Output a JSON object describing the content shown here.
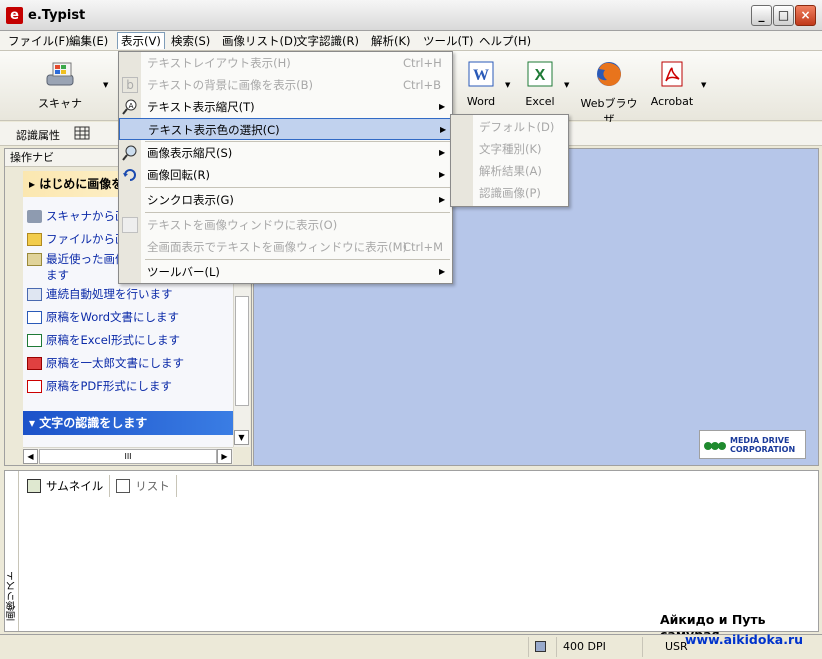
{
  "window": {
    "title": "e.Typist",
    "logo": "e",
    "minimize": "_",
    "maximize": "□",
    "close": "×"
  },
  "menubar": [
    {
      "label": "ファイル(F)"
    },
    {
      "label": "編集(E)"
    },
    {
      "label": "表示(V)"
    },
    {
      "label": "検索(S)"
    },
    {
      "label": "画像リスト(D)"
    },
    {
      "label": "文字認識(R)"
    },
    {
      "label": "解析(K)"
    },
    {
      "label": "ツール(T)"
    },
    {
      "label": "ヘルプ(H)"
    }
  ],
  "toolbar": {
    "scanner": "スキャナ",
    "word": "Word",
    "excel": "Excel",
    "browser": "Webブラウザ",
    "acrobat": "Acrobat"
  },
  "toolbar2": {
    "recognition_attr": "認識属性"
  },
  "left_panel": {
    "header": "操作ナビ",
    "section1": "はじめに画像を",
    "links": [
      "スキャナから画",
      "ファイルから画",
      "最近使った画像",
      "ます",
      "連続自動処理を行います",
      "原稿をWord文書にします",
      "原稿をExcel形式にします",
      "原稿を一太郎文書にします",
      "原稿をPDF形式にします"
    ],
    "section2": "文字の認識をします",
    "scroll_label": "III"
  },
  "viewer": {
    "logo_line1": "MEDIA DRIVE",
    "logo_line2": "CORPORATION"
  },
  "bottom_panel": {
    "side_label": "画像リスト",
    "tab_thumbnail": "サムネイル",
    "tab_list": "リスト"
  },
  "status": {
    "dpi": "400 DPI",
    "user": "USR"
  },
  "watermark": {
    "line1": "Айкидо и Путь самурая",
    "line2": "www.aikidoka.ru"
  },
  "view_menu": {
    "items": [
      {
        "label": "テキストレイアウト表示(H)",
        "shortcut": "Ctrl+H",
        "disabled": true
      },
      {
        "label": "テキストの背景に画像を表示(B)",
        "shortcut": "Ctrl+B",
        "disabled": true
      },
      {
        "label": "テキスト表示縮尺(T)",
        "submenu": true
      },
      {
        "label": "テキスト表示色の選択(C)",
        "submenu": true,
        "highlighted": true
      },
      {
        "label": "画像表示縮尺(S)",
        "submenu": true
      },
      {
        "label": "画像回転(R)",
        "submenu": true
      },
      {
        "label": "シンクロ表示(G)",
        "submenu": true
      },
      {
        "label": "テキストを画像ウィンドウに表示(O)",
        "disabled": true
      },
      {
        "label": "全画面表示でテキストを画像ウィンドウに表示(M)",
        "shortcut": "Ctrl+M",
        "disabled": true
      },
      {
        "label": "ツールバー(L)",
        "submenu": true
      }
    ],
    "arrow": "▶"
  },
  "color_submenu": [
    "デフォルト(D)",
    "文字種別(K)",
    "解析結果(A)",
    "認識画像(P)"
  ]
}
